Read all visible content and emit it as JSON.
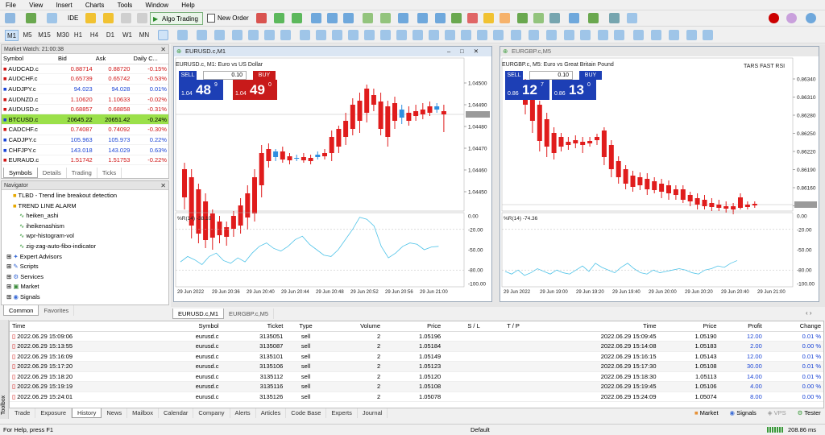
{
  "menu": [
    "File",
    "View",
    "Insert",
    "Charts",
    "Tools",
    "Window",
    "Help"
  ],
  "toolbar": {
    "ide": "IDE",
    "algo": "Algo Trading",
    "neworder": "New Order"
  },
  "timeframes": [
    "M1",
    "M5",
    "M15",
    "M30",
    "H1",
    "H4",
    "D1",
    "W1",
    "MN"
  ],
  "market_watch": {
    "title": "Market Watch: 21:00:38",
    "headers": [
      "Symbol",
      "Bid",
      "Ask",
      "Daily C..."
    ],
    "rows": [
      {
        "s": "AUDCAD.c",
        "b": "0.88714",
        "a": "0.88720",
        "c": "-0.15%",
        "dir": "red"
      },
      {
        "s": "AUDCHF.c",
        "b": "0.65739",
        "a": "0.65742",
        "c": "-0.53%",
        "dir": "red"
      },
      {
        "s": "AUDJPY.c",
        "b": "94.023",
        "a": "94.028",
        "c": "0.01%",
        "dir": "blue"
      },
      {
        "s": "AUDNZD.c",
        "b": "1.10620",
        "a": "1.10633",
        "c": "-0.02%",
        "dir": "red"
      },
      {
        "s": "AUDUSD.c",
        "b": "0.68857",
        "a": "0.68858",
        "c": "-0.31%",
        "dir": "red"
      },
      {
        "s": "BTCUSD.c",
        "b": "20645.22",
        "a": "20651.42",
        "c": "-0.24%",
        "dir": "hl"
      },
      {
        "s": "CADCHF.c",
        "b": "0.74087",
        "a": "0.74092",
        "c": "-0.30%",
        "dir": "red"
      },
      {
        "s": "CADJPY.c",
        "b": "105.963",
        "a": "105.973",
        "c": "0.22%",
        "dir": "blue"
      },
      {
        "s": "CHFJPY.c",
        "b": "143.018",
        "a": "143.029",
        "c": "0.63%",
        "dir": "blue"
      },
      {
        "s": "EURAUD.c",
        "b": "1.51742",
        "a": "1.51753",
        "c": "-0.22%",
        "dir": "red"
      }
    ],
    "tabs": [
      "Symbols",
      "Details",
      "Trading",
      "Ticks"
    ]
  },
  "navigator": {
    "title": "Navigator",
    "items": [
      "TLBD - Trend line breakout detection",
      "TREND LINE ALARM",
      "heiken_ashi",
      "iheikenashism",
      "wpr-histogram-vol",
      "zig-zag-auto-fibo-indicator",
      "Expert Advisors",
      "Scripts",
      "Services",
      "Market",
      "Signals"
    ],
    "tabs": [
      "Common",
      "Favorites"
    ]
  },
  "chart1": {
    "window_title": "EURUSD.c,M1",
    "header": "EURUSD.c, M1: Euro vs US Dollar",
    "sell": "SELL",
    "buy": "BUY",
    "lot": "0.10",
    "sell_pre": "1.04",
    "sell_big": "48",
    "sell_sup": "9",
    "buy_pre": "1.04",
    "buy_big": "49",
    "buy_sup": "0",
    "price_axis": [
      "1.04500",
      "1.04490",
      "1.04480",
      "1.04470",
      "1.04460",
      "1.04450"
    ],
    "wpr_label": "%R(14) -38.10",
    "wpr_axis": [
      "0.00",
      "-20.00",
      "-50.00",
      "-80.00",
      "-100.00"
    ],
    "time_axis": [
      "29 Jun 2022",
      "29 Jun 20:36",
      "29 Jun 20:40",
      "29 Jun 20:44",
      "29 Jun 20:48",
      "29 Jun 20:52",
      "29 Jun 20:56",
      "29 Jun 21:00"
    ]
  },
  "chart2": {
    "window_title": "EURGBP.c,M5",
    "header": "EURGBP.c, M5: Euro vs Great Britain Pound",
    "indicator": "TARS FAST RSI",
    "sell": "SELL",
    "buy": "BUY",
    "lot": "0.10",
    "sell_pre": "0.86",
    "sell_big": "12",
    "sell_sup": "7",
    "buy_pre": "0.86",
    "buy_big": "13",
    "buy_sup": "0",
    "price_axis": [
      "0.86340",
      "0.86310",
      "0.86280",
      "0.86250",
      "0.86220",
      "0.86190",
      "0.86160",
      "0.86130"
    ],
    "wpr_label": "%R(14) -74.36",
    "wpr_axis": [
      "0.00",
      "-20.00",
      "-50.00",
      "-80.00",
      "-100.00"
    ],
    "time_axis": [
      "29 Jun 2022",
      "29 Jun 19:00",
      "29 Jun 19:20",
      "29 Jun 19:40",
      "29 Jun 20:00",
      "29 Jun 20:20",
      "29 Jun 20:40",
      "29 Jun 21:00"
    ]
  },
  "chart_tabs": [
    "EURUSD.c,M1",
    "EURGBP.c,M5"
  ],
  "history": {
    "headers": [
      "Time",
      "Symbol",
      "Ticket",
      "Type",
      "Volume",
      "Price",
      "S / L",
      "T / P",
      "Time",
      "Price",
      "Profit",
      "Change"
    ],
    "rows": [
      [
        "2022.06.29 15:09:06",
        "eurusd.c",
        "3135051",
        "sell",
        "2",
        "1.05196",
        "",
        "",
        "2022.06.29 15:09:45",
        "1.05190",
        "12.00",
        "0.01 %"
      ],
      [
        "2022.06.29 15:13:55",
        "eurusd.c",
        "3135087",
        "sell",
        "2",
        "1.05184",
        "",
        "",
        "2022.06.29 15:14:08",
        "1.05183",
        "2.00",
        "0.00 %"
      ],
      [
        "2022.06.29 15:16:09",
        "eurusd.c",
        "3135101",
        "sell",
        "2",
        "1.05149",
        "",
        "",
        "2022.06.29 15:16:15",
        "1.05143",
        "12.00",
        "0.01 %"
      ],
      [
        "2022.06.29 15:17:20",
        "eurusd.c",
        "3135106",
        "sell",
        "2",
        "1.05123",
        "",
        "",
        "2022.06.29 15:17:30",
        "1.05108",
        "30.00",
        "0.01 %"
      ],
      [
        "2022.06.29 15:18:20",
        "eurusd.c",
        "3135112",
        "sell",
        "2",
        "1.05120",
        "",
        "",
        "2022.06.29 15:18:30",
        "1.05113",
        "14.00",
        "0.01 %"
      ],
      [
        "2022.06.29 15:19:19",
        "eurusd.c",
        "3135116",
        "sell",
        "2",
        "1.05108",
        "",
        "",
        "2022.06.29 15:19:45",
        "1.05106",
        "4.00",
        "0.00 %"
      ],
      [
        "2022.06.29 15:24:01",
        "eurusd.c",
        "3135126",
        "sell",
        "2",
        "1.05078",
        "",
        "",
        "2022.06.29 15:24:09",
        "1.05074",
        "8.00",
        "0.00 %"
      ]
    ]
  },
  "bottom_tabs": [
    "Trade",
    "Exposure",
    "History",
    "News",
    "Mailbox",
    "Calendar",
    "Company",
    "Alerts",
    "Articles",
    "Code Base",
    "Experts",
    "Journal"
  ],
  "bottom_right": {
    "market": "Market",
    "signals": "Signals",
    "vps": "VPS",
    "tester": "Tester"
  },
  "toolbox_label": "Toolbox",
  "status": {
    "help": "For Help, press F1",
    "profile": "Default",
    "net": "208.86 ms"
  }
}
